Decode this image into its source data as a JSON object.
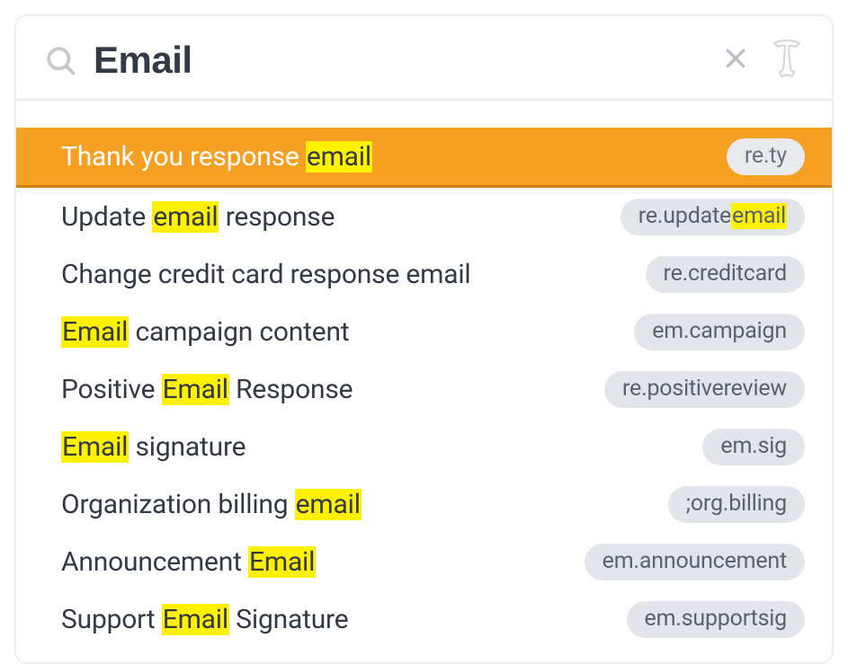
{
  "search": {
    "value": "Email",
    "placeholder": "Search"
  },
  "colors": {
    "selected_bg": "#f5a022",
    "selected_underline": "#cf7e0f",
    "highlight_bg": "#fff100",
    "text": "#333a45",
    "pill_bg": "#e2e5ea",
    "pill_text": "#5a6270",
    "border": "#eceef1"
  },
  "icons": {
    "search": "search-icon",
    "clear": "close-icon",
    "brand": "textexpander-t-icon"
  },
  "results": [
    {
      "selected": true,
      "title_parts": [
        {
          "t": "Thank you response ",
          "h": false
        },
        {
          "t": "email",
          "h": true
        }
      ],
      "tag_parts": [
        {
          "t": "re.ty",
          "h": false
        }
      ]
    },
    {
      "selected": false,
      "title_parts": [
        {
          "t": "Update ",
          "h": false
        },
        {
          "t": "email",
          "h": true
        },
        {
          "t": " response",
          "h": false
        }
      ],
      "tag_parts": [
        {
          "t": "re.update",
          "h": false
        },
        {
          "t": "email",
          "h": true
        }
      ]
    },
    {
      "selected": false,
      "title_parts": [
        {
          "t": "Change credit card response email",
          "h": false
        }
      ],
      "tag_parts": [
        {
          "t": "re.creditcard",
          "h": false
        }
      ]
    },
    {
      "selected": false,
      "title_parts": [
        {
          "t": "Email",
          "h": true
        },
        {
          "t": " campaign content",
          "h": false
        }
      ],
      "tag_parts": [
        {
          "t": "em.campaign",
          "h": false
        }
      ]
    },
    {
      "selected": false,
      "title_parts": [
        {
          "t": "Positive ",
          "h": false
        },
        {
          "t": "Email",
          "h": true
        },
        {
          "t": " Response",
          "h": false
        }
      ],
      "tag_parts": [
        {
          "t": "re.positivereview",
          "h": false
        }
      ]
    },
    {
      "selected": false,
      "title_parts": [
        {
          "t": "Email",
          "h": true
        },
        {
          "t": " signature",
          "h": false
        }
      ],
      "tag_parts": [
        {
          "t": "em.sig",
          "h": false
        }
      ]
    },
    {
      "selected": false,
      "title_parts": [
        {
          "t": "Organization billing ",
          "h": false
        },
        {
          "t": "email",
          "h": true
        }
      ],
      "tag_parts": [
        {
          "t": ";org.billing",
          "h": false
        }
      ]
    },
    {
      "selected": false,
      "title_parts": [
        {
          "t": "Announcement ",
          "h": false
        },
        {
          "t": "Email",
          "h": true
        }
      ],
      "tag_parts": [
        {
          "t": "em.announcement",
          "h": false
        }
      ]
    },
    {
      "selected": false,
      "title_parts": [
        {
          "t": "Support ",
          "h": false
        },
        {
          "t": "Email",
          "h": true
        },
        {
          "t": " Signature",
          "h": false
        }
      ],
      "tag_parts": [
        {
          "t": "em.supportsig",
          "h": false
        }
      ]
    }
  ]
}
